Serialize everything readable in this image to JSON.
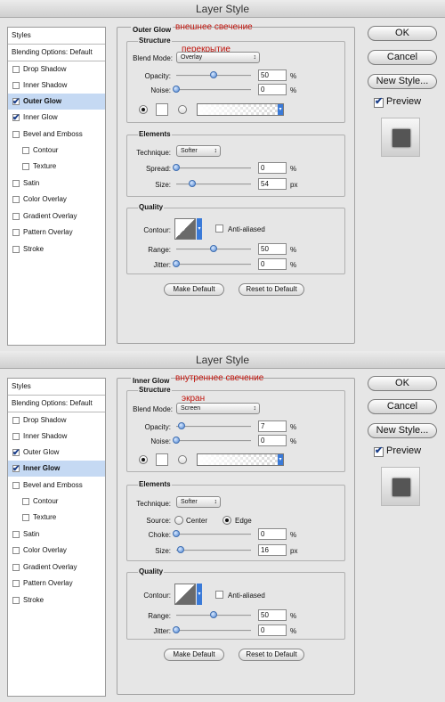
{
  "window_title": "Layer Style",
  "buttons": {
    "ok": "OK",
    "cancel": "Cancel",
    "new_style": "New Style...",
    "preview": "Preview"
  },
  "list": {
    "styles": "Styles",
    "blending": "Blending Options: Default",
    "items": [
      "Drop Shadow",
      "Inner Shadow",
      "Outer Glow",
      "Inner Glow",
      "Bevel and Emboss",
      "Contour",
      "Texture",
      "Satin",
      "Color Overlay",
      "Gradient Overlay",
      "Pattern Overlay",
      "Stroke"
    ]
  },
  "dlg1": {
    "panel_title": "Outer Glow",
    "annotation_title": "внешнее свечение",
    "annotation_mode": "перекрытие",
    "structure": "Structure",
    "blend_mode_label": "Blend Mode:",
    "blend_mode_value": "Overlay",
    "opacity_label": "Opacity:",
    "opacity_value": "50",
    "noise_label": "Noise:",
    "noise_value": "0",
    "elements": "Elements",
    "technique_label": "Technique:",
    "technique_value": "Softer",
    "spread_label": "Spread:",
    "spread_value": "0",
    "size_label": "Size:",
    "size_value": "54",
    "quality": "Quality",
    "contour_label": "Contour:",
    "anti_aliased": "Anti-aliased",
    "range_label": "Range:",
    "range_value": "50",
    "jitter_label": "Jitter:",
    "jitter_value": "0",
    "make_default": "Make Default",
    "reset_default": "Reset to Default",
    "pct": "%",
    "px": "px",
    "opacity_level": 0.5,
    "noise_level": 0,
    "spread_level": 0,
    "size_level": 0.22,
    "range_level": 0.5,
    "jitter_level": 0
  },
  "dlg2": {
    "panel_title": "Inner Glow",
    "annotation_title": "внутреннее свечение",
    "annotation_mode": "экран",
    "structure": "Structure",
    "blend_mode_label": "Blend Mode:",
    "blend_mode_value": "Screen",
    "opacity_label": "Opacity:",
    "opacity_value": "7",
    "noise_label": "Noise:",
    "noise_value": "0",
    "elements": "Elements",
    "technique_label": "Technique:",
    "technique_value": "Softer",
    "source_label": "Source:",
    "source_center": "Center",
    "source_edge": "Edge",
    "choke_label": "Choke:",
    "choke_value": "0",
    "size_label": "Size:",
    "size_value": "16",
    "quality": "Quality",
    "contour_label": "Contour:",
    "anti_aliased": "Anti-aliased",
    "range_label": "Range:",
    "range_value": "50",
    "jitter_label": "Jitter:",
    "jitter_value": "0",
    "make_default": "Make Default",
    "reset_default": "Reset to Default",
    "pct": "%",
    "px": "px",
    "opacity_level": 0.07,
    "noise_level": 0,
    "choke_level": 0,
    "size_level": 0.06,
    "range_level": 0.5,
    "jitter_level": 0
  },
  "colors": {
    "selection": "#c5d9f3",
    "annotation": "#c0140c",
    "slider_thumb": "#4f86d3"
  }
}
